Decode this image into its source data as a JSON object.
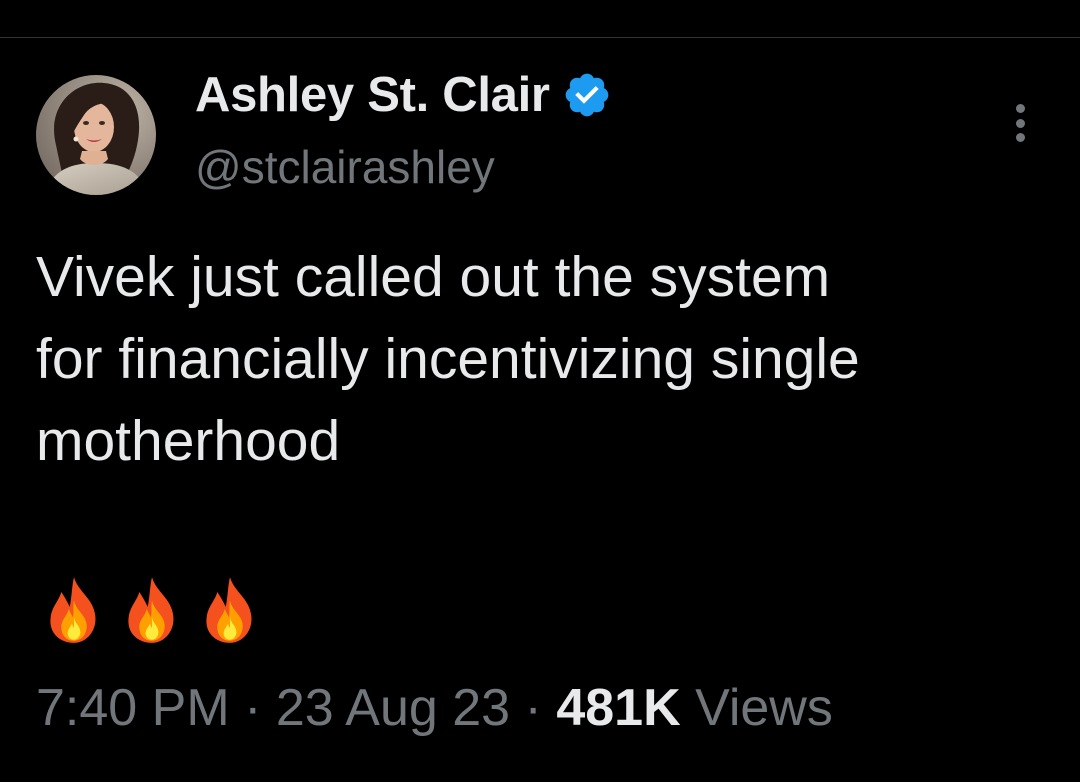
{
  "author": {
    "display_name": "Ashley St. Clair",
    "handle": "@stclairashley",
    "verified": true,
    "verified_color": "#1d9bf0"
  },
  "tweet": {
    "text": "Vivek just called out the system\nfor financially incentivizing single\nmotherhood",
    "emojis": [
      "fire-icon",
      "fire-icon",
      "fire-icon"
    ]
  },
  "meta": {
    "time": "7:40 PM",
    "separator": " · ",
    "date": "23 Aug 23",
    "views_count": "481K",
    "views_label": " Views"
  },
  "colors": {
    "background": "#000000",
    "text_primary": "#e7e9ea",
    "text_secondary": "#71767b"
  }
}
